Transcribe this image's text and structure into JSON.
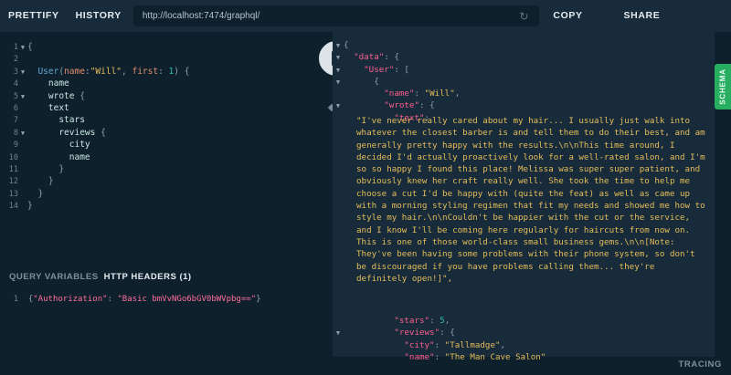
{
  "toolbar": {
    "prettify": "PRETTIFY",
    "history": "HISTORY",
    "url": "http://localhost:7474/graphql/",
    "copy_curl": "COPY CURL",
    "share": "SHARE PLAYGROUND"
  },
  "query": {
    "line_numbers": [
      "1",
      "2",
      "3",
      "4",
      "5",
      "6",
      "7",
      "8",
      "9",
      "10",
      "11",
      "12",
      "13",
      "14"
    ],
    "fn": "User",
    "arg1": "name",
    "val1": "\"Will\"",
    "arg2": "first",
    "val2": "1",
    "f_name": "name",
    "f_wrote": "wrote",
    "f_text": "text",
    "f_stars": "stars",
    "f_reviews": "reviews",
    "f_city": "city",
    "f_name2": "name"
  },
  "variables": {
    "tab_query_vars": "QUERY VARIABLES",
    "tab_http_headers": "HTTP HEADERS (1)",
    "line_number": "1",
    "header_key": "\"Authorization\"",
    "header_value": "\"Basic bmVvNGo6bGV0bWVpbg==\""
  },
  "result": {
    "k_data": "\"data\"",
    "k_user": "\"User\"",
    "k_name": "\"name\"",
    "v_name": "\"Will\"",
    "k_wrote": "\"wrote\"",
    "k_text": "\"text\"",
    "text_value": "\"I've never really cared about my hair... I usually just walk into whatever the closest barber is and tell them to do their best, and am generally pretty happy with the results.\\n\\nThis time around, I decided I'd actually proactively look for a well-rated salon, and I'm so so happy I found this place! Melissa was super super patient, and obviously knew her craft really well. She took the time to help me choose a cut I'd be happy with (quite the feat) as well as came up with a morning styling regimen that fit my needs and showed me how to style my hair.\\n\\nCouldn't be happier with the cut or the service, and I know I'll be coming here regularly for haircuts from now on. This is one of those world-class small business gems.\\n\\n[Note: They've been having some problems with their phone system, so don't be discouraged if you have problems calling them... they're definitely open!]\",",
    "k_stars": "\"stars\"",
    "v_stars": "5",
    "k_reviews": "\"reviews\"",
    "k_city": "\"city\"",
    "v_city": "\"Tallmadge\"",
    "k_name2": "\"name\"",
    "v_name2": "\"The Man Cave Salon\""
  },
  "side": {
    "schema": "SCHEMA",
    "tracing": "TRACING"
  },
  "colors": {
    "background": "#0f202d",
    "panel": "#172b3a",
    "schema_green": "#27ae60",
    "string": "#e6bd5a",
    "key": "#ff5e8f"
  }
}
